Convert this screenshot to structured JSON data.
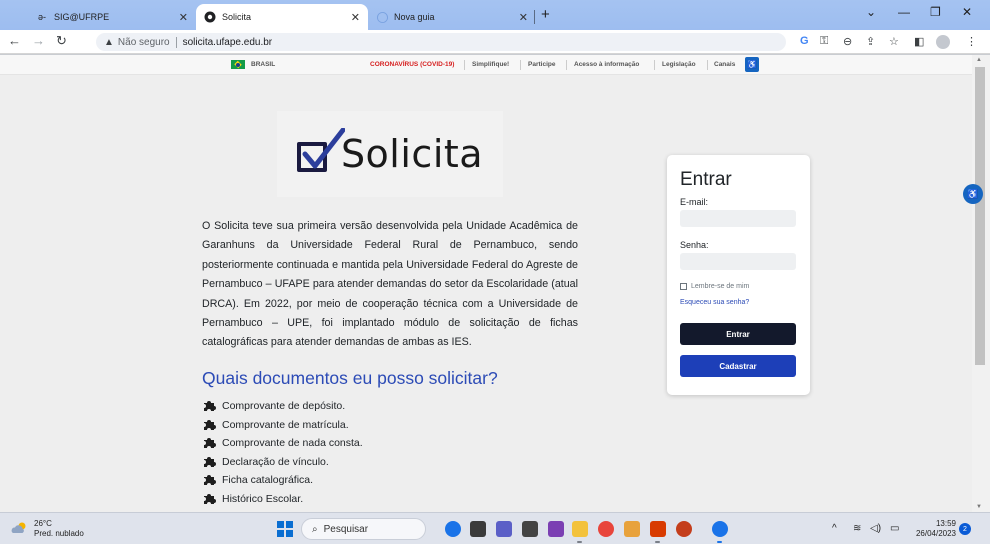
{
  "browser": {
    "tabs": [
      {
        "title": "SIG@UFRPE",
        "favicon": "sig-icon"
      },
      {
        "title": "Solicita",
        "favicon": "solicita-icon",
        "active": true
      },
      {
        "title": "Nova guia",
        "favicon": "chrome-icon"
      }
    ],
    "address": {
      "security": "Não seguro",
      "url": "solicita.ufape.edu.br"
    }
  },
  "govbar": {
    "brasil": "BRASIL",
    "links": [
      "CORONAVÍRUS (COVID-19)",
      "Simplifique!",
      "Participe",
      "Acesso à informação",
      "Legislação",
      "Canais"
    ]
  },
  "page": {
    "logo_text": "Solicita",
    "intro": "O Solicita teve sua primeira versão desenvolvida pela Unidade Acadêmica de Garanhuns da Universidade Federal Rural de Pernambuco, sendo posteriormente continuada e mantida pela Universidade Federal do Agreste de Pernambuco – UFAPE para atender demandas do setor da Escolaridade (atual DRCA). Em 2022, por meio de cooperação técnica com a Universidade de Pernambuco – UPE, foi implantado módulo de solicitação de fichas catalográficas para atender demandas de ambas as IES.",
    "documents_heading": "Quais documentos eu posso solicitar?",
    "documents": [
      "Comprovante de depósito.",
      "Comprovante de matrícula.",
      "Comprovante de nada consta.",
      "Declaração de vínculo.",
      "Ficha catalográfica.",
      "Histórico Escolar."
    ]
  },
  "login": {
    "title": "Entrar",
    "email_label": "E-mail:",
    "password_label": "Senha:",
    "remember_label": "Lembre-se de mim",
    "forgot_label": "Esqueceu sua senha?",
    "submit_label": "Entrar",
    "register_label": "Cadastrar"
  },
  "taskbar": {
    "weather_temp": "26°C",
    "weather_desc": "Pred. nublado",
    "search_placeholder": "Pesquisar",
    "time": "13:59",
    "date": "26/04/2023",
    "notifications": "2"
  }
}
